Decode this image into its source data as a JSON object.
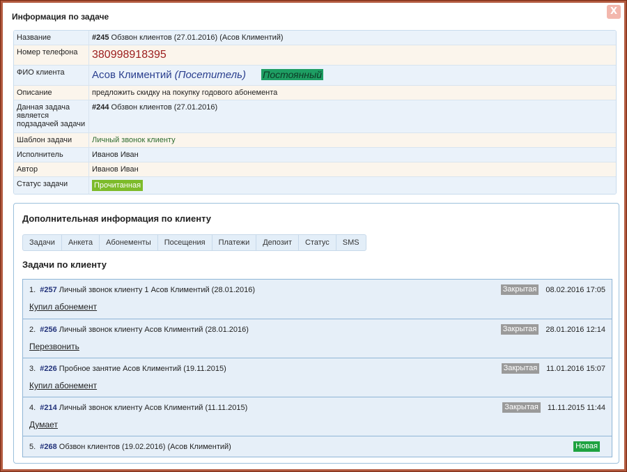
{
  "dialog": {
    "title": "Информация по задаче",
    "close_label": "X"
  },
  "info": {
    "name_label": "Название",
    "name_id": "#245",
    "name_text": "Обзвон клиентов (27.01.2016) (Асов Климентий)",
    "phone_label": "Номер телефона",
    "phone_value": "380998918395",
    "client_label": "ФИО клиента",
    "client_name": "Асов Климентий",
    "client_role": "(Посетитель)",
    "client_badge": "Постоянный",
    "desc_label": "Описание",
    "desc_value": "предложить скидку на покупку годового абонемента",
    "parent_label": "Данная задача является подзадачей задачи",
    "parent_id": "#244",
    "parent_text": "Обзвон клиентов (27.01.2016)",
    "template_label": "Шаблон задачи",
    "template_value": "Личный звонок клиенту",
    "executor_label": "Исполнитель",
    "executor_value": "Иванов Иван",
    "author_label": "Автор",
    "author_value": "Иванов Иван",
    "status_label": "Статус задачи",
    "status_value": "Прочитанная"
  },
  "extra": {
    "title": "Дополнительная информация по клиенту",
    "tabs": [
      "Задачи",
      "Анкета",
      "Абонементы",
      "Посещения",
      "Платежи",
      "Депозит",
      "Статус",
      "SMS"
    ],
    "tasks_heading": "Задачи по клиенту"
  },
  "tasks": [
    {
      "num": "1.",
      "id": "#257",
      "text": "Личный звонок клиенту 1 Асов Климентий (28.01.2016)",
      "badge": "Закрытая",
      "date": "08.02.2016 17:05",
      "note": "Купил абонемент"
    },
    {
      "num": "2.",
      "id": "#256",
      "text": "Личный звонок клиенту Асов Климентий (28.01.2016)",
      "badge": "Закрытая",
      "date": "28.01.2016 12:14",
      "note": "Перезвонить"
    },
    {
      "num": "3.",
      "id": "#226",
      "text": "Пробное занятие Асов Климентий (19.11.2015)",
      "badge": "Закрытая",
      "date": "11.01.2016 15:07",
      "note": "Купил абонемент"
    },
    {
      "num": "4.",
      "id": "#214",
      "text": "Личный звонок клиенту Асов Климентий (11.11.2015)",
      "badge": "Закрытая",
      "date": "11.11.2015 11:44",
      "note": "Думает"
    },
    {
      "num": "5.",
      "id": "#268",
      "text": "Обзвон клиентов (19.02.2016) (Асов Климентий)",
      "badge": "Новая"
    }
  ],
  "colors": {
    "closed_badge": "#9a9a9a",
    "new_badge": "#1ea240",
    "status_badge": "#7dbb2a",
    "regular_badge": "#1e9e63",
    "phone": "#9b1c1c"
  }
}
